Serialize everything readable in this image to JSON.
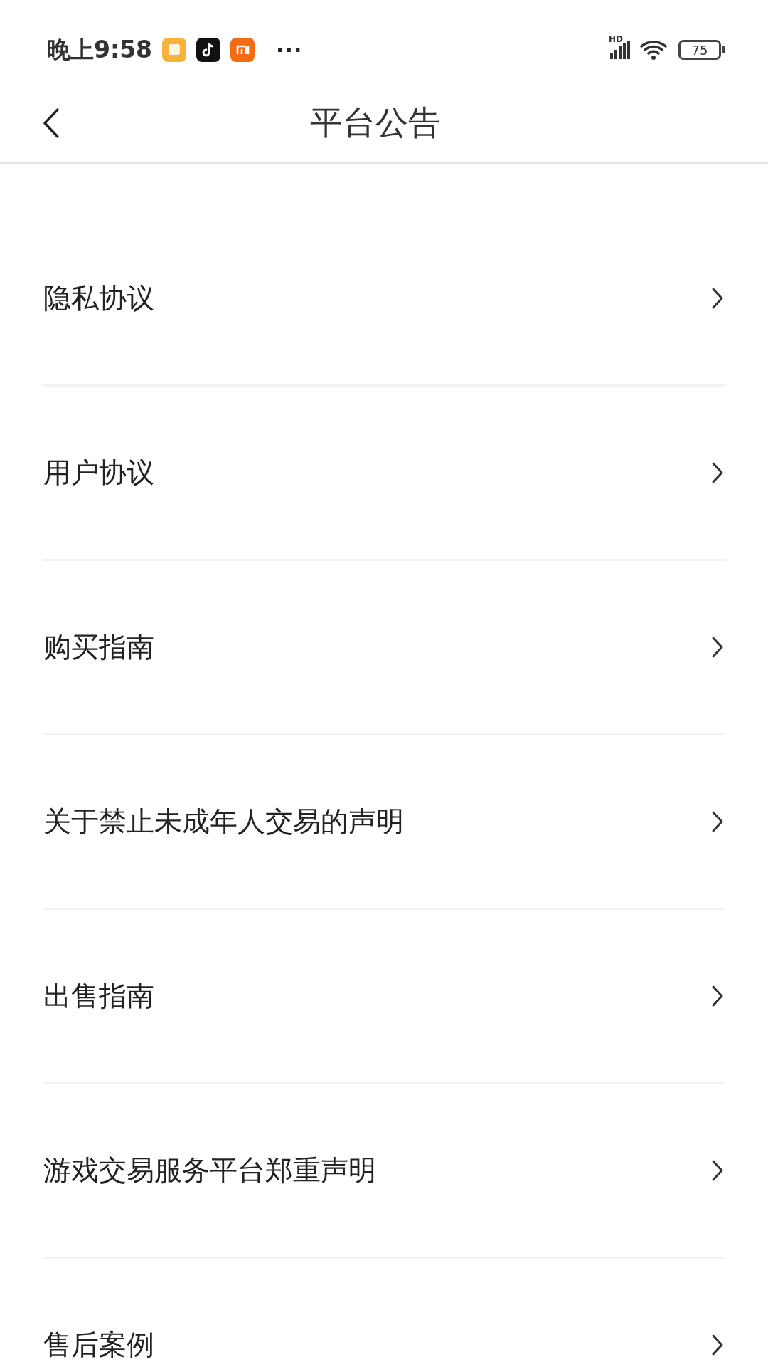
{
  "status_bar": {
    "time": "晚上9:58",
    "overflow": "···",
    "network": "HD",
    "battery": "75"
  },
  "nav": {
    "title": "平台公告"
  },
  "items": [
    {
      "label": "隐私协议"
    },
    {
      "label": "用户协议"
    },
    {
      "label": "购买指南"
    },
    {
      "label": "关于禁止未成年人交易的声明"
    },
    {
      "label": "出售指南"
    },
    {
      "label": "游戏交易服务平台郑重声明"
    },
    {
      "label": "售后案例"
    }
  ]
}
